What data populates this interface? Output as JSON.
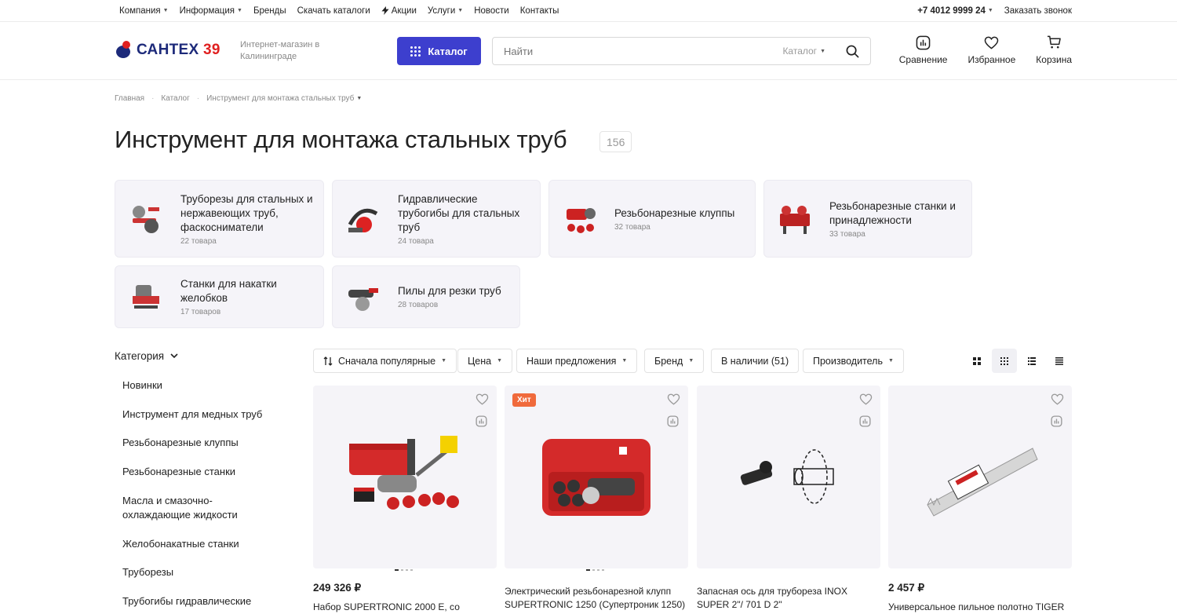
{
  "topbar": {
    "menu": [
      {
        "label": "Компания",
        "dropdown": true
      },
      {
        "label": "Информация",
        "dropdown": true
      },
      {
        "label": "Бренды",
        "dropdown": false
      },
      {
        "label": "Скачать каталоги",
        "dropdown": false
      },
      {
        "label": "Акции",
        "dropdown": false,
        "icon": "lightning-icon"
      },
      {
        "label": "Услуги",
        "dropdown": true
      },
      {
        "label": "Новости",
        "dropdown": false
      },
      {
        "label": "Контакты",
        "dropdown": false
      }
    ],
    "phone": "+7 4012 9999 24",
    "callback": "Заказать звонок"
  },
  "header": {
    "logo_text": "САНТЕХ",
    "logo_num": "39",
    "tagline": "Интернет-магазин в Калининграде",
    "catalog_button": "Каталог",
    "search_placeholder": "Найти",
    "search_scope": "Каталог",
    "icons": [
      {
        "label": "Сравнение",
        "icon": "compare-icon"
      },
      {
        "label": "Избранное",
        "icon": "heart-icon"
      },
      {
        "label": "Корзина",
        "icon": "cart-icon"
      }
    ]
  },
  "breadcrumb": [
    "Главная",
    "Каталог",
    "Инструмент для монтажа стальных труб"
  ],
  "page": {
    "title": "Инструмент для монтажа стальных труб",
    "count": "156"
  },
  "categories": [
    {
      "name": "Труборезы для стальных и нержавеющих труб, фаскосниматели",
      "count": "22 товара"
    },
    {
      "name": "Гидравлические трубогибы для стальных труб",
      "count": "24 товара"
    },
    {
      "name": "Резьбонарезные клуппы",
      "count": "32 товара"
    },
    {
      "name": "Резьбонарезные станки и принадлежности",
      "count": "33 товара"
    },
    {
      "name": "Станки для накатки желобков",
      "count": "17 товаров"
    },
    {
      "name": "Пилы для резки труб",
      "count": "28 товаров"
    }
  ],
  "sidebar": {
    "title": "Категория",
    "items": [
      "Новинки",
      "Инструмент для медных труб",
      "Резьбонарезные клуппы",
      "Резьбонарезные станки",
      "Масла и смазочно-охлаждающие жидкости",
      "Желобонакатные станки",
      "Труборезы",
      "Трубогибы гидравлические"
    ]
  },
  "filters": {
    "sort": "Сначала популярные",
    "price": "Цена",
    "offers": "Наши предложения",
    "brand": "Бренд",
    "in_stock": "В наличии (51)",
    "manufacturer": "Производитель"
  },
  "products": [
    {
      "price": "249 326 ₽",
      "name": "Набор SUPERTRONIC 2000 E, со",
      "badge": ""
    },
    {
      "price": "",
      "name": "Электрический резьбонарезной клупп SUPERTRONIC 1250 (Супертроник 1250)",
      "badge": "Хит"
    },
    {
      "price": "",
      "name": "Запасная ось для трубореза INOX SUPER 2\"/ 701 D 2\"",
      "badge": ""
    },
    {
      "price": "2 457 ₽",
      "name": "Универсальное пильное полотно TIGER",
      "badge": ""
    }
  ]
}
